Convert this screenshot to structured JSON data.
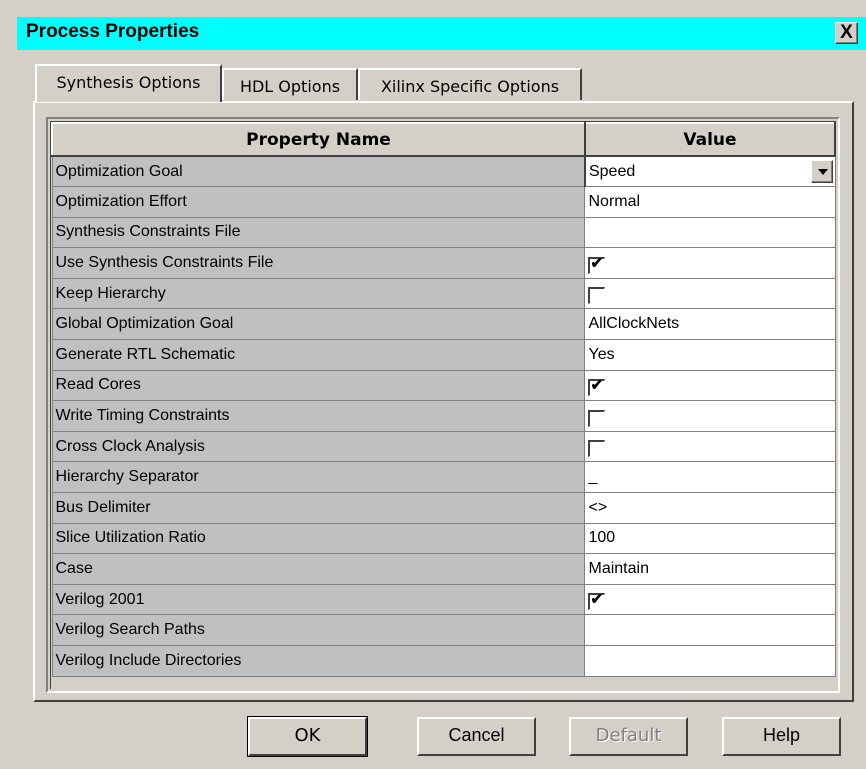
{
  "window": {
    "title": "Process Properties",
    "close_label": "X"
  },
  "tabs": [
    {
      "label": "Synthesis Options",
      "active": true
    },
    {
      "label": "HDL Options",
      "active": false
    },
    {
      "label": "Xilinx Specific Options",
      "active": false
    }
  ],
  "table": {
    "headers": {
      "name": "Property Name",
      "value": "Value"
    },
    "rows": [
      {
        "name": "Optimization Goal",
        "type": "dropdown",
        "value": "Speed"
      },
      {
        "name": "Optimization Effort",
        "type": "text",
        "value": "Normal"
      },
      {
        "name": "Synthesis Constraints File",
        "type": "text",
        "value": ""
      },
      {
        "name": "Use Synthesis Constraints File",
        "type": "checkbox",
        "checked": true
      },
      {
        "name": "Keep Hierarchy",
        "type": "checkbox",
        "checked": false
      },
      {
        "name": "Global Optimization Goal",
        "type": "text",
        "value": "AllClockNets"
      },
      {
        "name": "Generate RTL Schematic",
        "type": "text",
        "value": "Yes"
      },
      {
        "name": "Read Cores",
        "type": "checkbox",
        "checked": true
      },
      {
        "name": "Write Timing Constraints",
        "type": "checkbox",
        "checked": false
      },
      {
        "name": "Cross Clock Analysis",
        "type": "checkbox",
        "checked": false
      },
      {
        "name": "Hierarchy Separator",
        "type": "text",
        "value": "_"
      },
      {
        "name": "Bus Delimiter",
        "type": "text",
        "value": "<>"
      },
      {
        "name": "Slice Utilization Ratio",
        "type": "text",
        "value": "100"
      },
      {
        "name": "Case",
        "type": "text",
        "value": "Maintain"
      },
      {
        "name": "Verilog 2001",
        "type": "checkbox",
        "checked": true
      },
      {
        "name": "Verilog Search Paths",
        "type": "text",
        "value": ""
      },
      {
        "name": "Verilog Include Directories",
        "type": "text",
        "value": ""
      }
    ]
  },
  "buttons": {
    "ok": "OK",
    "cancel": "Cancel",
    "default": "Default",
    "help": "Help"
  },
  "colors": {
    "title_bar": "#00ffff",
    "dialog_face": "#d4d0c8",
    "name_column": "#c0c0c0",
    "value_column": "#ffffff"
  }
}
